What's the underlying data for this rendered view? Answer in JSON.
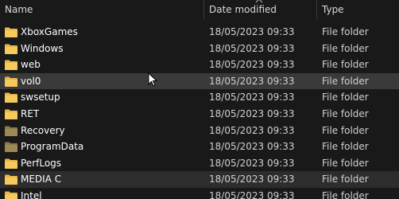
{
  "columns": {
    "name": "Name",
    "date_modified": "Date modified",
    "type": "Type"
  },
  "icons": {
    "folder": "folder-icon",
    "folder_hidden": "folder-icon",
    "sort": "chevron-up-icon",
    "cursor": "mouse-pointer-icon"
  },
  "colors": {
    "folder": "#e8b64a",
    "folder_hidden": "#8a7a48",
    "hover_row": "#3a3a3a"
  },
  "files": [
    {
      "name": "XboxGames",
      "date": "18/05/2023 09:33",
      "type": "File folder"
    },
    {
      "name": "Windows",
      "date": "18/05/2023 09:33",
      "type": "File folder"
    },
    {
      "name": "web",
      "date": "18/05/2023 09:33",
      "type": "File folder"
    },
    {
      "name": "vol0",
      "date": "18/05/2023 09:33",
      "type": "File folder"
    },
    {
      "name": "swsetup",
      "date": "18/05/2023 09:33",
      "type": "File folder"
    },
    {
      "name": "RET",
      "date": "18/05/2023 09:33",
      "type": "File folder"
    },
    {
      "name": "Recovery",
      "date": "18/05/2023 09:33",
      "type": "File folder"
    },
    {
      "name": "ProgramData",
      "date": "18/05/2023 09:33",
      "type": "File folder"
    },
    {
      "name": "PerfLogs",
      "date": "18/05/2023 09:33",
      "type": "File folder"
    },
    {
      "name": "MEDIA C",
      "date": "18/05/2023 09:33",
      "type": "File folder"
    },
    {
      "name": "Intel",
      "date": "18/05/2023 09:33",
      "type": "File folder"
    }
  ]
}
